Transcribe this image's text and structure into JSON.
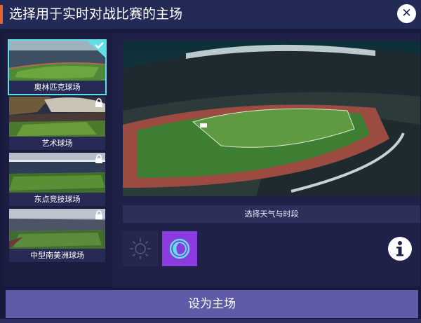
{
  "window": {
    "title": "选择用于实时对战比赛的主场"
  },
  "close_button": {
    "icon": "close-icon",
    "glyph": "✕"
  },
  "stadiums": [
    {
      "name": "奥林匹克球场",
      "selected": true,
      "locked": false
    },
    {
      "name": "艺术球场",
      "selected": false,
      "locked": true
    },
    {
      "name": "东点竞技球场",
      "selected": false,
      "locked": true
    },
    {
      "name": "中型南美洲球场",
      "selected": false,
      "locked": true
    }
  ],
  "weather": {
    "label": "选择天气与时段",
    "options": [
      {
        "id": "day",
        "icon": "sun-icon",
        "selected": false
      },
      {
        "id": "night",
        "icon": "moon-icon",
        "selected": true
      }
    ]
  },
  "info_button": {
    "icon": "info-icon"
  },
  "confirm_button": {
    "label": "设为主场"
  },
  "colors": {
    "accent": "#e8632b",
    "selection": "#5fe0e6",
    "night_selected": "#8b3ce0",
    "confirm": "#5f5ba9"
  }
}
